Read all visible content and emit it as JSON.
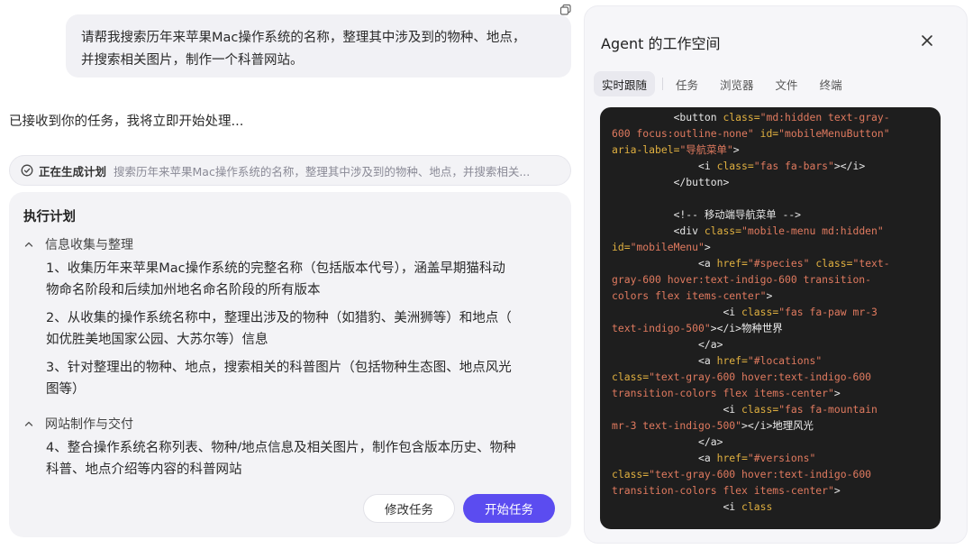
{
  "chat": {
    "user_message_line1": "请帮我搜索历年来苹果Mac操作系统的名称，整理其中涉及到的物种、地点，",
    "user_message_line2": "并搜索相关图片，制作一个科普网站。",
    "ack": "已接收到你的任务，我将立即开始处理...",
    "plan_status_label": "正在生成计划",
    "plan_status_preview": "搜索历年来苹果Mac操作系统的名称，整理其中涉及到的物种、地点，并搜索相关..."
  },
  "plan": {
    "title": "执行计划",
    "sections": [
      {
        "title": "信息收集与整理",
        "steps": [
          {
            "line1": "1、收集历年来苹果Mac操作系统的完整名称（包括版本代号），涵盖早期猫科动",
            "line2": "物命名阶段和后续加州地名命名阶段的所有版本"
          },
          {
            "line1": "2、从收集的操作系统名称中，整理出涉及的物种（如猎豹、美洲狮等）和地点（",
            "line2": "如优胜美地国家公园、大苏尔等）信息"
          },
          {
            "line1": "3、针对整理出的物种、地点，搜索相关的科普图片（包括物种生态图、地点风光",
            "line2": "图等）"
          }
        ]
      },
      {
        "title": "网站制作与交付",
        "steps": [
          {
            "line1": "4、整合操作系统名称列表、物种/地点信息及相关图片，制作包含版本历史、物种",
            "line2": "科普、地点介绍等内容的科普网站"
          }
        ]
      }
    ],
    "edit_button": "修改任务",
    "start_button": "开始任务"
  },
  "workspace": {
    "title": "Agent 的工作空间",
    "tabs": [
      "实时跟随",
      "任务",
      "浏览器",
      "文件",
      "终端"
    ],
    "active_tab": "实时跟随"
  },
  "colors": {
    "accent": "#5b4cf0",
    "code_bg": "#1e1e1e",
    "code_attr": "#e0b040",
    "code_string": "#e07a5f",
    "panel_bg": "#f3f3f6"
  },
  "icons": [
    "copy-icon",
    "check-circle-icon",
    "chevron-up-icon",
    "close-icon"
  ]
}
